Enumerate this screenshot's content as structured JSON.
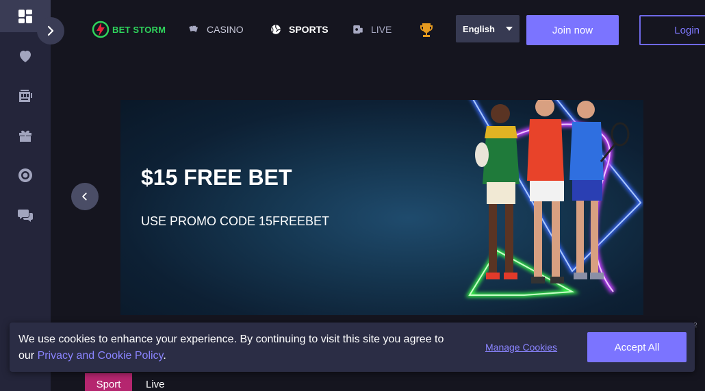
{
  "brand": {
    "name": "BET STORM",
    "accent": "#2fd45c",
    "primary": "#7b74ff"
  },
  "sidebar": {
    "items": [
      {
        "icon": "dashboard-icon",
        "active": true
      },
      {
        "icon": "heart-icon",
        "active": false
      },
      {
        "icon": "slot-machine-icon",
        "active": false
      },
      {
        "icon": "gift-icon",
        "active": false
      },
      {
        "icon": "lifebuoy-icon",
        "active": false
      },
      {
        "icon": "help-chat-icon",
        "active": false
      }
    ],
    "toggle_icon": "chevron-right-icon"
  },
  "nav": {
    "casino": "CASINO",
    "sports": "SPORTS",
    "live": "LIVE",
    "trophy_icon": "trophy-icon"
  },
  "language": {
    "selected": "English"
  },
  "auth": {
    "join": "Join now",
    "login": "Login"
  },
  "promo": {
    "title": "$15 FREE BET",
    "subtitle": "USE PROMO CODE 15FREEBET",
    "slide_indicator": "2"
  },
  "tabs": {
    "sport": "Sport",
    "live": "Live"
  },
  "cookie": {
    "text_before": "We use cookies to enhance your experience. By continuing to visit this site you agree to our ",
    "policy_link": "Privacy and Cookie Policy",
    "text_after": ".",
    "manage": "Manage Cookies",
    "accept": "Accept All"
  }
}
